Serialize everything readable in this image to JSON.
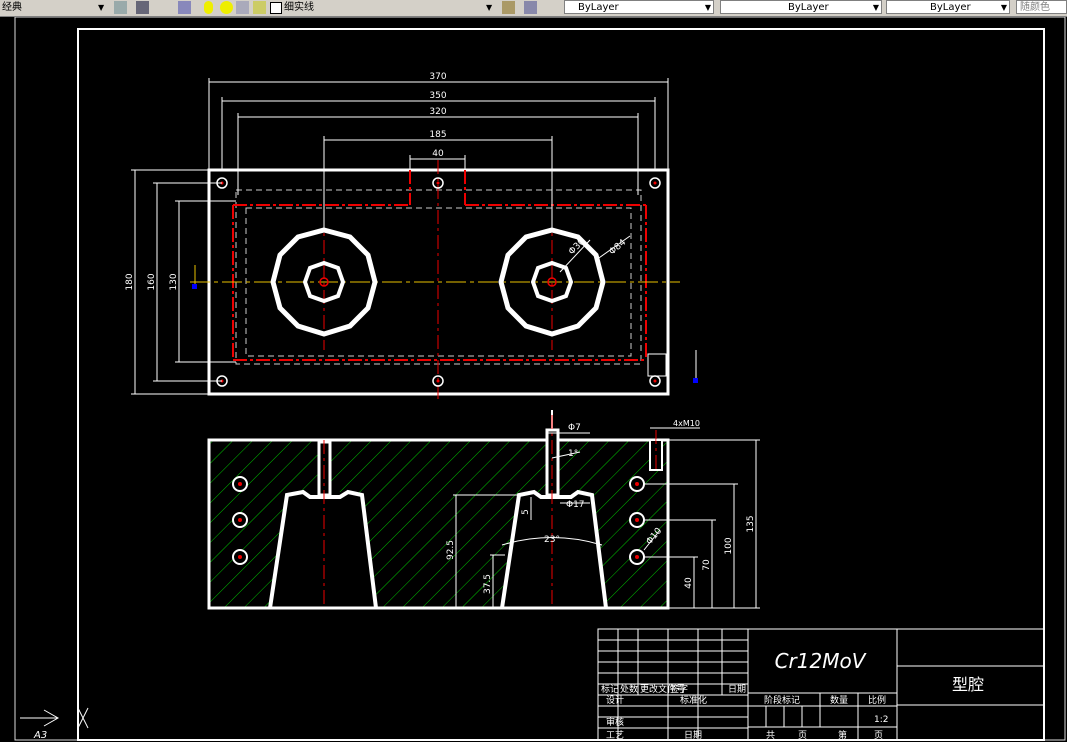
{
  "toolbar": {
    "left_fragment": "经典",
    "layer_name": "细实线",
    "color_combo": "ByLayer",
    "linetype_combo": "ByLayer",
    "lineweight_combo": "ByLayer",
    "plotstyle_combo": "随颜色"
  },
  "top_view": {
    "dims": [
      "370",
      "350",
      "320",
      "185",
      "40"
    ],
    "vdims": [
      "180",
      "160",
      "130"
    ],
    "diam_small": "Φ30",
    "diam_large": "Φ84"
  },
  "section_view": {
    "dim_d7": "Φ7",
    "dim_thread": "4xM10",
    "dim_1deg": "1°",
    "dim_d17": "Φ17",
    "dim_5": "5",
    "dim_23deg": "23°",
    "dim_92_5": "92.5",
    "dim_37_5": "37.5",
    "dim_d10": "Φ10",
    "dim_135": "135",
    "dim_100": "100",
    "dim_70": "70",
    "dim_40": "40"
  },
  "title_block": {
    "material": "Cr12MoV",
    "part_name": "型腔",
    "h_mark": "标记",
    "h_count": "处数",
    "h_doc": "更改文件号",
    "h_sign": "签字",
    "h_date": "日期",
    "designer": "设计",
    "standardize": "标准化",
    "review": "审核",
    "process": "工艺",
    "date2": "日期",
    "stage_mark": "阶段标记",
    "weight": "数量",
    "scale": "比例",
    "scale_value": "1:2",
    "total_label": "共",
    "sheet_unit": "页",
    "sheet_label": "第",
    "sheet_unit2": "页"
  },
  "ucs": {
    "sheet_size": "A3"
  }
}
